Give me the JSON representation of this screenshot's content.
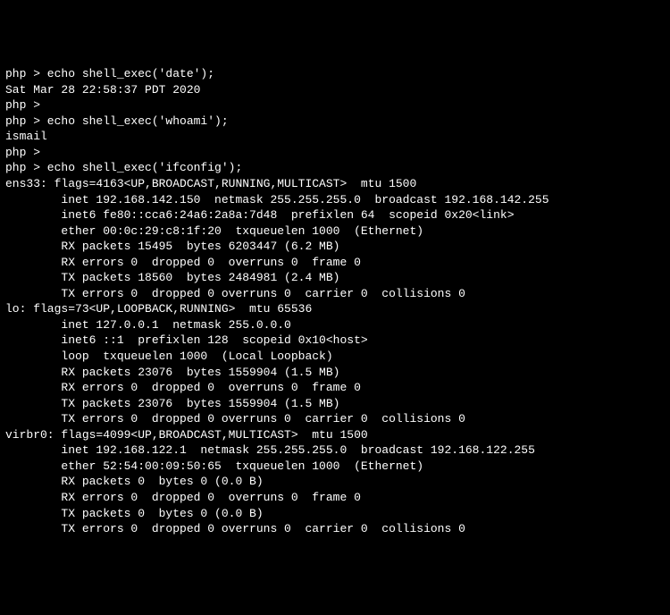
{
  "lines": [
    "php > echo shell_exec('date');",
    "Sat Mar 28 22:58:37 PDT 2020",
    "php >",
    "php > echo shell_exec('whoami');",
    "ismail",
    "php >",
    "php > echo shell_exec('ifconfig');",
    "ens33: flags=4163<UP,BROADCAST,RUNNING,MULTICAST>  mtu 1500",
    "        inet 192.168.142.150  netmask 255.255.255.0  broadcast 192.168.142.255",
    "        inet6 fe80::cca6:24a6:2a8a:7d48  prefixlen 64  scopeid 0x20<link>",
    "        ether 00:0c:29:c8:1f:20  txqueuelen 1000  (Ethernet)",
    "        RX packets 15495  bytes 6203447 (6.2 MB)",
    "        RX errors 0  dropped 0  overruns 0  frame 0",
    "        TX packets 18560  bytes 2484981 (2.4 MB)",
    "        TX errors 0  dropped 0 overruns 0  carrier 0  collisions 0",
    "",
    "lo: flags=73<UP,LOOPBACK,RUNNING>  mtu 65536",
    "        inet 127.0.0.1  netmask 255.0.0.0",
    "        inet6 ::1  prefixlen 128  scopeid 0x10<host>",
    "        loop  txqueuelen 1000  (Local Loopback)",
    "        RX packets 23076  bytes 1559904 (1.5 MB)",
    "        RX errors 0  dropped 0  overruns 0  frame 0",
    "        TX packets 23076  bytes 1559904 (1.5 MB)",
    "        TX errors 0  dropped 0 overruns 0  carrier 0  collisions 0",
    "",
    "virbr0: flags=4099<UP,BROADCAST,MULTICAST>  mtu 1500",
    "        inet 192.168.122.1  netmask 255.255.255.0  broadcast 192.168.122.255",
    "        ether 52:54:00:09:50:65  txqueuelen 1000  (Ethernet)",
    "        RX packets 0  bytes 0 (0.0 B)",
    "        RX errors 0  dropped 0  overruns 0  frame 0",
    "        TX packets 0  bytes 0 (0.0 B)",
    "        TX errors 0  dropped 0 overruns 0  carrier 0  collisions 0"
  ]
}
